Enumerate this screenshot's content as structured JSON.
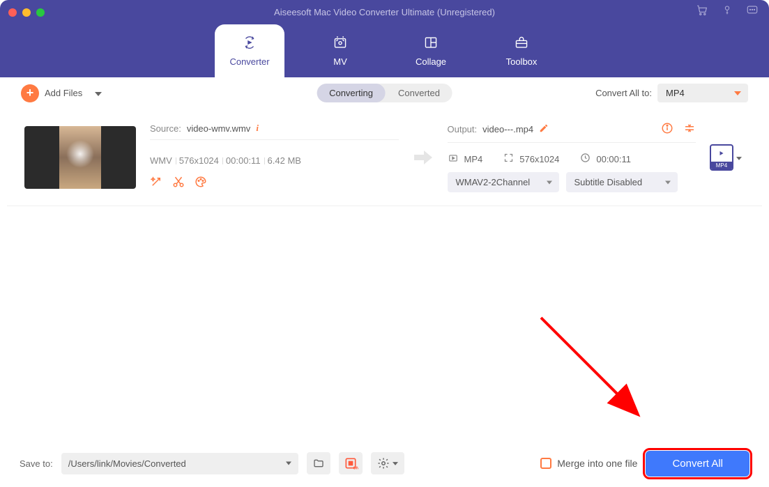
{
  "window": {
    "title": "Aiseesoft Mac Video Converter Ultimate (Unregistered)"
  },
  "traffic": {
    "close": "#ff5f57",
    "min": "#febc2e",
    "max": "#28c840"
  },
  "nav": {
    "tabs": [
      {
        "label": "Converter",
        "icon": "converter-icon",
        "active": true
      },
      {
        "label": "MV",
        "icon": "mv-icon",
        "active": false
      },
      {
        "label": "Collage",
        "icon": "collage-icon",
        "active": false
      },
      {
        "label": "Toolbox",
        "icon": "toolbox-icon",
        "active": false
      }
    ]
  },
  "subbar": {
    "add_files_label": "Add Files",
    "tabs": {
      "converting": "Converting",
      "converted": "Converted"
    },
    "convert_all_to_label": "Convert All to:",
    "convert_all_to_value": "MP4"
  },
  "file": {
    "source": {
      "label": "Source:",
      "name": "video-wmv.wmv",
      "meta": {
        "format": "WMV",
        "resolution": "576x1024",
        "duration": "00:00:11",
        "size": "6.42 MB"
      }
    },
    "output": {
      "label": "Output:",
      "name": "video---.mp4",
      "meta": {
        "format": "MP4",
        "resolution": "576x1024",
        "duration": "00:00:11"
      },
      "audio_select": "WMAV2-2Channel",
      "subtitle_select": "Subtitle Disabled",
      "format_badge": "MP4"
    }
  },
  "bottom": {
    "save_to_label": "Save to:",
    "save_to_path": "/Users/link/Movies/Converted",
    "merge_label": "Merge into one file",
    "convert_all_label": "Convert All"
  }
}
